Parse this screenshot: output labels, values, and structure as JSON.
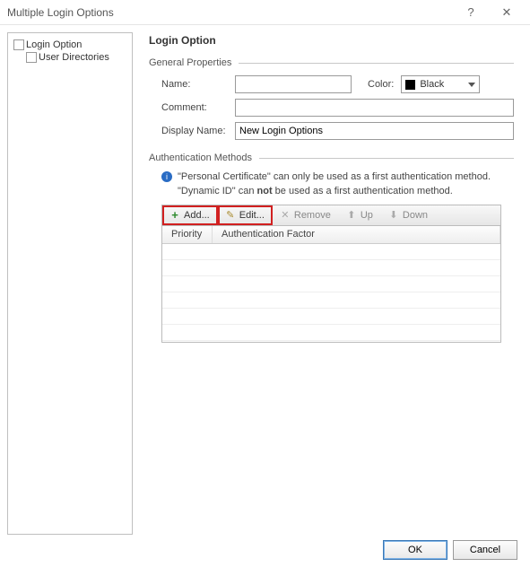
{
  "window": {
    "title": "Multiple Login Options",
    "help": "?",
    "close": "✕"
  },
  "tree": {
    "root": "Login Option",
    "child": "User Directories"
  },
  "main": {
    "heading": "Login Option",
    "general": {
      "title": "General Properties",
      "name_label": "Name:",
      "name_value": "",
      "color_label": "Color:",
      "color_value": "Black",
      "color_hex": "#000000",
      "comment_label": "Comment:",
      "comment_value": "",
      "display_label": "Display Name:",
      "display_value": "New Login Options"
    },
    "auth": {
      "title": "Authentication Methods",
      "info_line1": "\"Personal Certificate\" can only be used as a first authentication method.",
      "info_line2_pre": "\"Dynamic ID\" can ",
      "info_line2_bold": "not",
      "info_line2_post": " be used as a first authentication method.",
      "toolbar": {
        "add": "Add...",
        "edit": "Edit...",
        "remove": "Remove",
        "up": "Up",
        "down": "Down"
      },
      "columns": {
        "priority": "Priority",
        "factor": "Authentication Factor"
      }
    }
  },
  "footer": {
    "ok": "OK",
    "cancel": "Cancel"
  }
}
